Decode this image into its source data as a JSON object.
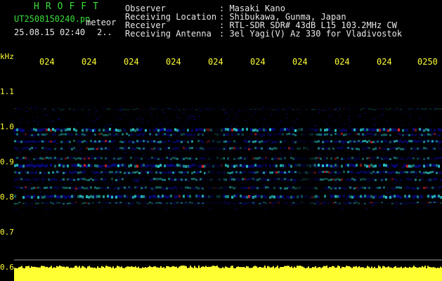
{
  "header": {
    "brand": "HROFFT",
    "filename": "UT2508150240.pn",
    "mode": "meteor",
    "datetime": "25.08.15 02:40",
    "extra": "2..",
    "fields": [
      {
        "label": "Observer",
        "value": ": Masaki Kano"
      },
      {
        "label": "Receiving Location",
        "value": ": Shibukawa, Gunma, Japan"
      },
      {
        "label": "Receiver",
        "value": ": RTL-SDR SDR# 43dB L15 103.2MHz CW"
      },
      {
        "label": "Receiving Antenna",
        "value": ": 3el Yagi(V) Az 330 for Vladivostok"
      }
    ]
  },
  "y_axis": {
    "unit": "kHz",
    "ticks": [
      "1.1",
      "1.0",
      "0.9",
      "0.8",
      "0.7",
      "0.6"
    ]
  },
  "x_axis": {
    "ticks": [
      "024",
      "024",
      "024",
      "024",
      "024",
      "024",
      "024",
      "024",
      "024",
      "0250"
    ]
  },
  "colors": {
    "background": "#000000",
    "noise_band": "#0a0aa0",
    "echo_high": "#ff3030",
    "echo_mid": "#30e0e0",
    "baseline": "#ffff33"
  }
}
